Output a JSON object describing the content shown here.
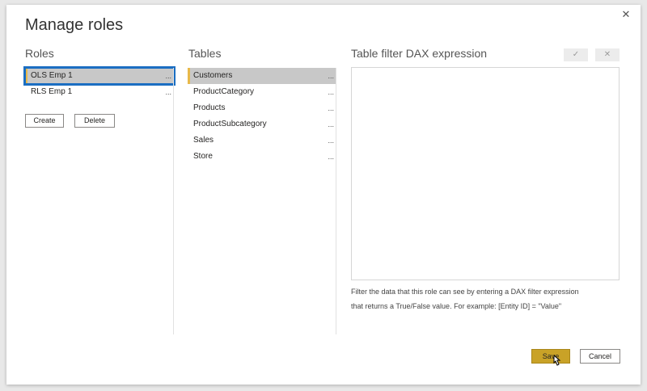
{
  "dialog": {
    "title": "Manage roles",
    "close_icon": "close-icon"
  },
  "roles": {
    "heading": "Roles",
    "items": [
      {
        "label": "OLS Emp 1",
        "menu": "...",
        "selected": true
      },
      {
        "label": "RLS Emp 1",
        "menu": "...",
        "selected": false
      }
    ],
    "create_label": "Create",
    "delete_label": "Delete"
  },
  "tables": {
    "heading": "Tables",
    "items": [
      {
        "label": "Customers",
        "menu": "...",
        "selected": true
      },
      {
        "label": "ProductCategory",
        "menu": "..."
      },
      {
        "label": "Products",
        "menu": "..."
      },
      {
        "label": "ProductSubcategory",
        "menu": "..."
      },
      {
        "label": "Sales",
        "menu": "..."
      },
      {
        "label": "Store",
        "menu": "..."
      }
    ]
  },
  "dax": {
    "heading": "Table filter DAX expression",
    "value": "",
    "check_icon": "checkmark-icon",
    "clear_icon": "close-icon",
    "hint_line1": "Filter the data that this role can see by entering a DAX filter expression",
    "hint_line2": "that returns a True/False value. For example: [Entity ID] = \"Value\""
  },
  "footer": {
    "save_label": "Save",
    "cancel_label": "Cancel"
  },
  "colors": {
    "accent": "#c9a227",
    "selection_bar": "#e8b94a",
    "highlight_border": "#1b6ec2"
  }
}
